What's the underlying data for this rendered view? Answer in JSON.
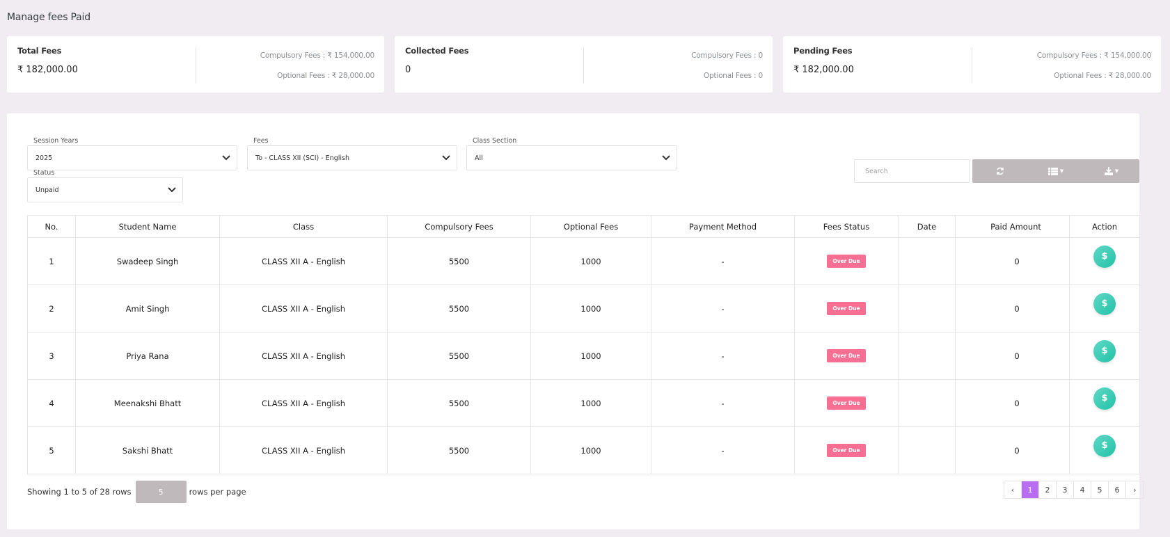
{
  "page": {
    "title": "Manage fees Paid"
  },
  "stats": [
    {
      "label": "Total Fees",
      "value": "₹ 182,000.00",
      "compulsory": "Compulsory Fees : ₹ 154,000.00",
      "optional": "Optional Fees : ₹ 28,000.00"
    },
    {
      "label": "Collected Fees",
      "value": "0",
      "compulsory": "Compulsory Fees : 0",
      "optional": "Optional Fees : 0"
    },
    {
      "label": "Pending Fees",
      "value": "₹ 182,000.00",
      "compulsory": "Compulsory Fees : ₹ 154,000.00",
      "optional": "Optional Fees : ₹ 28,000.00"
    }
  ],
  "filters": {
    "session_years": {
      "label": "Session Years",
      "value": "2025"
    },
    "fees": {
      "label": "Fees",
      "value": "To - CLASS XII (SCI) - English"
    },
    "class_section": {
      "label": "Class Section",
      "value": "All"
    },
    "status": {
      "label": "Status",
      "value": "Unpaid"
    }
  },
  "search": {
    "placeholder": "Search"
  },
  "toolbar": {
    "refresh_icon": "refresh-icon",
    "columns_icon": "columns-icon",
    "export_icon": "download-icon"
  },
  "table": {
    "headers": [
      "No.",
      "Student Name",
      "Class",
      "Compulsory Fees",
      "Optional Fees",
      "Payment Method",
      "Fees Status",
      "Date",
      "Paid Amount",
      "Action"
    ],
    "rows": [
      {
        "no": "1",
        "name": "Swadeep Singh",
        "class": "CLASS XII A - English",
        "compulsory": "5500",
        "optional": "1000",
        "method": "-",
        "status": "Over Due",
        "date": "",
        "paid": "0",
        "action": "$"
      },
      {
        "no": "2",
        "name": "Amit Singh",
        "class": "CLASS XII A - English",
        "compulsory": "5500",
        "optional": "1000",
        "method": "-",
        "status": "Over Due",
        "date": "",
        "paid": "0",
        "action": "$"
      },
      {
        "no": "3",
        "name": "Priya Rana",
        "class": "CLASS XII A - English",
        "compulsory": "5500",
        "optional": "1000",
        "method": "-",
        "status": "Over Due",
        "date": "",
        "paid": "0",
        "action": "$"
      },
      {
        "no": "4",
        "name": "Meenakshi Bhatt",
        "class": "CLASS XII A - English",
        "compulsory": "5500",
        "optional": "1000",
        "method": "-",
        "status": "Over Due",
        "date": "",
        "paid": "0",
        "action": "$"
      },
      {
        "no": "5",
        "name": "Sakshi Bhatt",
        "class": "CLASS XII A - English",
        "compulsory": "5500",
        "optional": "1000",
        "method": "-",
        "status": "Over Due",
        "date": "",
        "paid": "0",
        "action": "$"
      }
    ]
  },
  "footer": {
    "showing": "Showing 1 to 5 of 28 rows",
    "rows_per_page_value": "5",
    "rows_per_page_label": "rows per page"
  },
  "pagination": {
    "prev": "‹",
    "pages": [
      "1",
      "2",
      "3",
      "4",
      "5",
      "6"
    ],
    "next": "›",
    "active": "1"
  },
  "colors": {
    "accent": "#b86df2",
    "badge": "#f76f93",
    "action": "#22c1a6",
    "toolbar": "#bfb9bb"
  }
}
